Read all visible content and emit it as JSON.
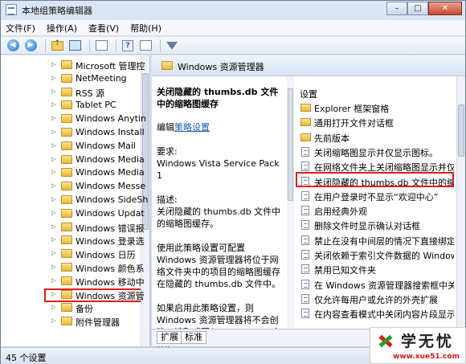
{
  "window": {
    "title": "本地组策略编辑器",
    "min": "–",
    "max": "□",
    "close": "✕"
  },
  "menu": [
    "文件(F)",
    "操作(A)",
    "查看(V)",
    "帮助(H)"
  ],
  "tree": [
    "Microsoft 管理控",
    "NetMeeting",
    "RSS 源",
    "Tablet PC",
    "Windows Anytin",
    "Windows Install",
    "Windows Mail",
    "Windows Media",
    "Windows Media",
    "Windows Messe",
    "Windows SideSh",
    "Windows Updat",
    "Windows 错误报",
    "Windows 登录选",
    "Windows 日历",
    "Windows 颜色系",
    "Windows 移动中",
    "Windows 资源管",
    "备份",
    "附件管理器"
  ],
  "right_header": "Windows 资源管理器",
  "description": {
    "title": "关闭隐藏的 thumbs.db 文件中的缩略图缓存",
    "edit_prefix": "编辑",
    "edit_link": "策略设置",
    "req_label": "要求:",
    "req_value": "Windows Vista Service Pack 1",
    "desc_label": "描述:",
    "desc_text": "关闭隐藏的 thumbs.db 文件中的缩略图缓存。",
    "detail": "使用此策略设置可配置 Windows 资源管理器将位于网络文件夹中的项目的缩略图缓存在隐藏的 thumbs.db 文件中。",
    "more": "如果启用此策略设置，则 Windows 资源管理器将不会创建、读取或写入 thumbs.db 文件。"
  },
  "settings_head": "设置",
  "settings": [
    {
      "type": "folder",
      "label": "Explorer 框架窗格"
    },
    {
      "type": "folder",
      "label": "通用打开文件对话框"
    },
    {
      "type": "folder",
      "label": "先前版本"
    },
    {
      "type": "page",
      "label": "关闭缩略图显示并仅显示图标。"
    },
    {
      "type": "page",
      "label": "在网络文件夹上关闭缩略图显示并仅显"
    },
    {
      "type": "page",
      "label": "关闭隐藏的 thumbs.db 文件中的缩略"
    },
    {
      "type": "page",
      "label": "在用户登录时不显示“欢迎中心”"
    },
    {
      "type": "page",
      "label": "启用经典外观"
    },
    {
      "type": "page",
      "label": "删除文件时显示确认对话框"
    },
    {
      "type": "page",
      "label": "禁止在没有中间层的情况下直接绑定到"
    },
    {
      "type": "page",
      "label": "关闭依赖于索引文件数据的 Windows"
    },
    {
      "type": "page",
      "label": "禁用已知文件夹"
    },
    {
      "type": "page",
      "label": "在 Windows 资源管理器搜索框中关闭"
    },
    {
      "type": "page",
      "label": "仅允许每用户或允许的外壳扩展"
    },
    {
      "type": "page",
      "label": "在内容查看模式中关闭内容片段显示"
    }
  ],
  "tabs": [
    "扩展",
    "标准"
  ],
  "status": "45 个设置",
  "watermark": {
    "text": "学无忧",
    "url": "www.xue51.com"
  }
}
